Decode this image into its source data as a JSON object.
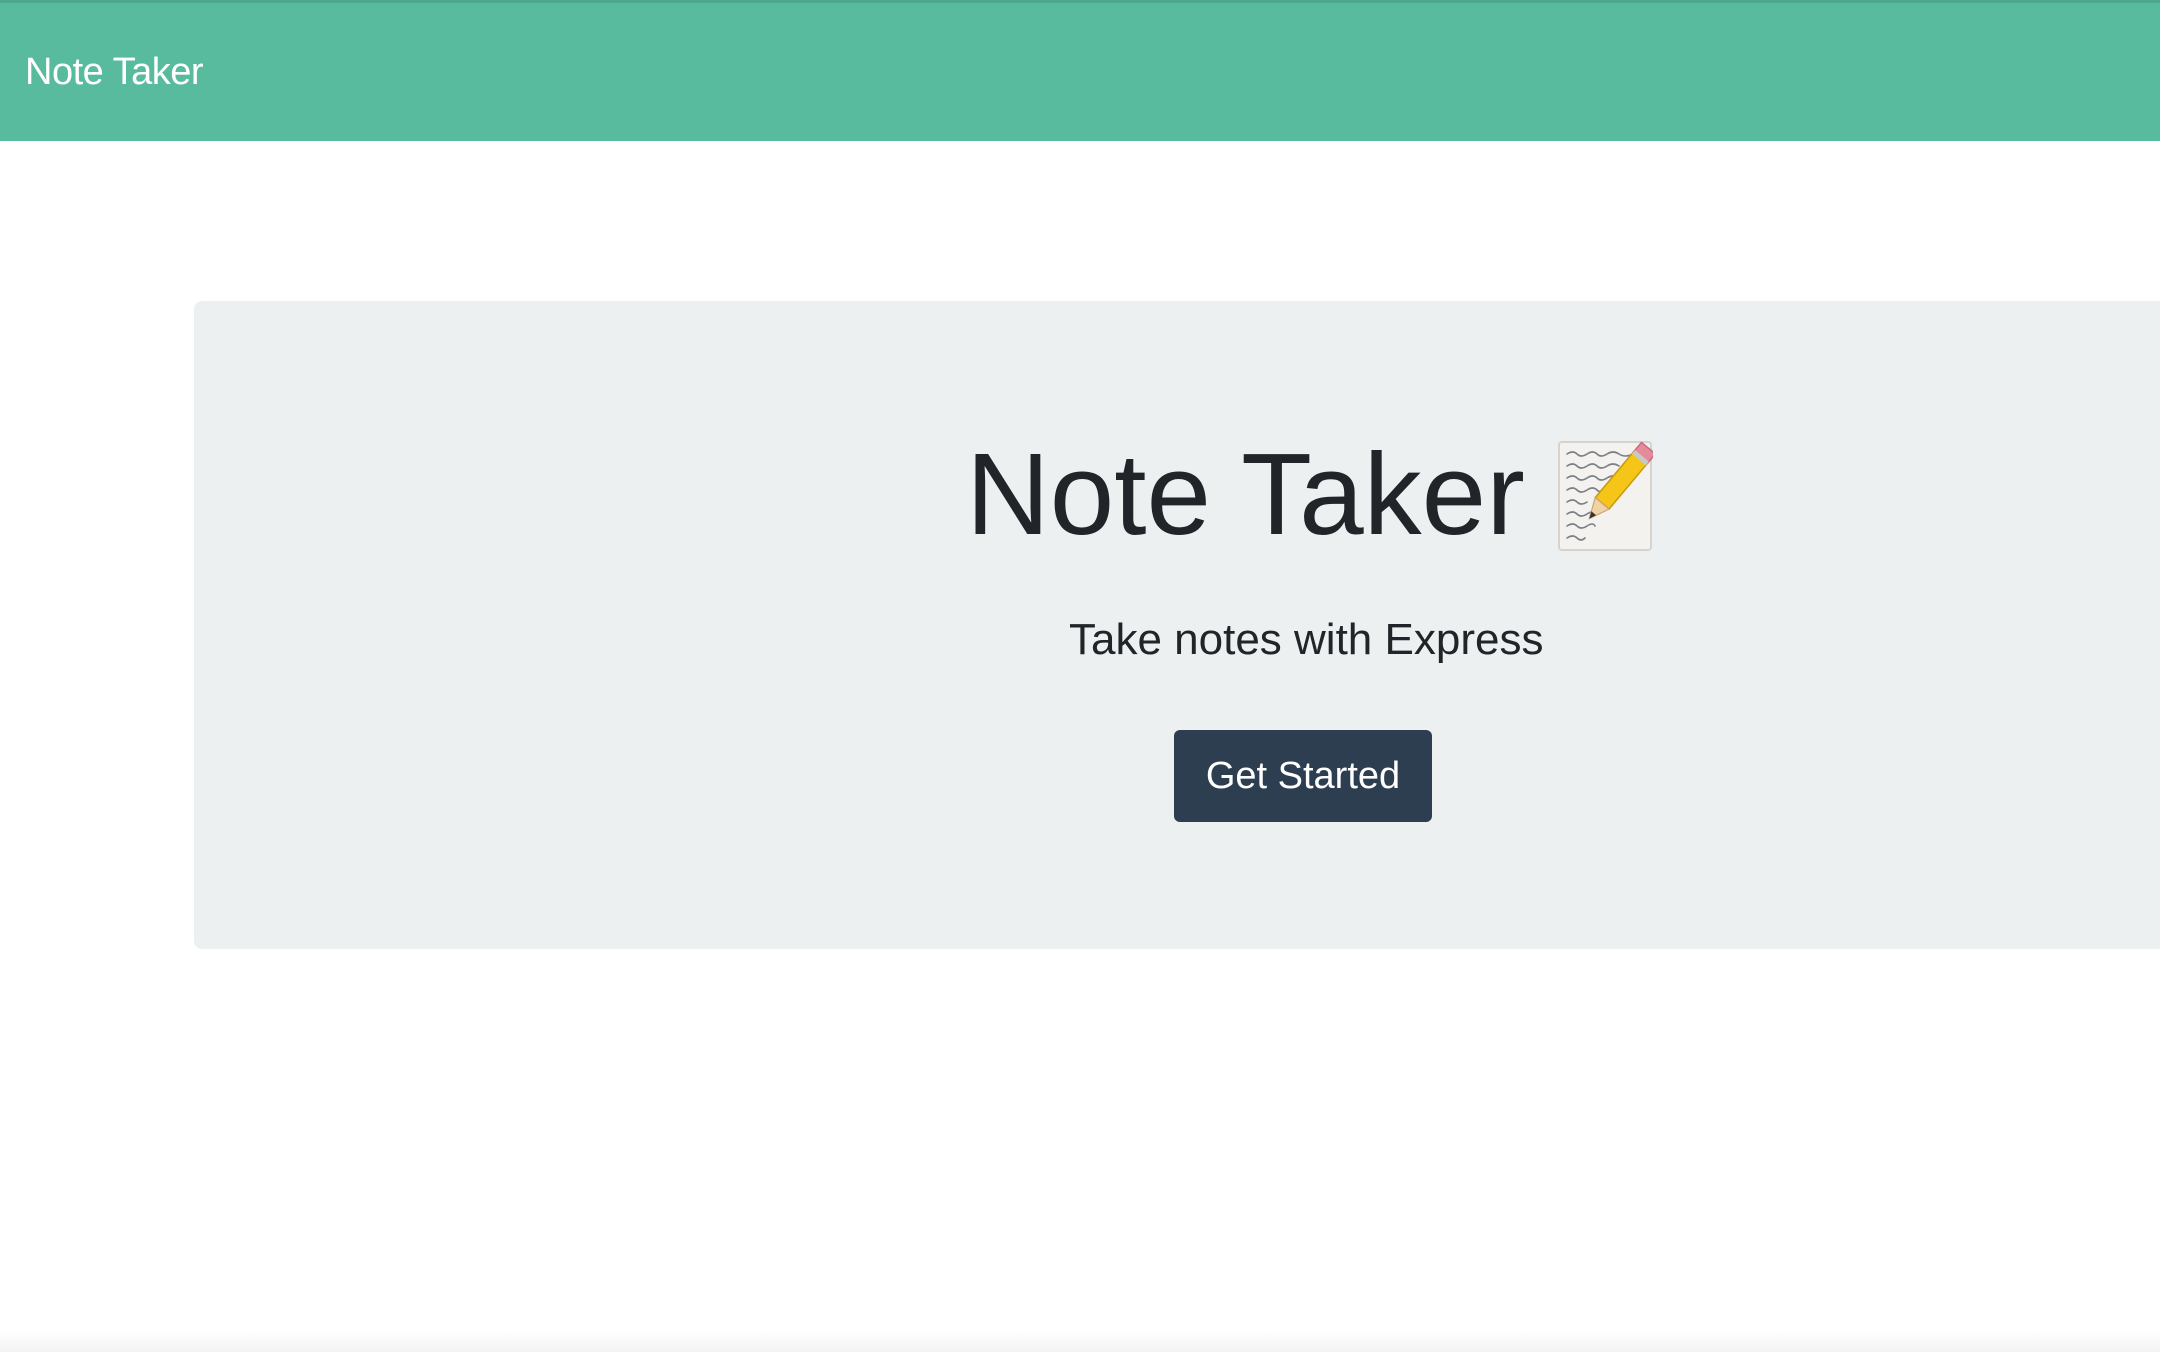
{
  "navbar": {
    "brand": "Note Taker"
  },
  "hero": {
    "title": "Note Taker",
    "title_icon": "memo-pencil-icon",
    "subtitle": "Take notes with Express",
    "cta_label": "Get Started"
  },
  "colors": {
    "navbar_bg": "#58bb9e",
    "hero_bg": "#ecf0f1",
    "button_bg": "#2d3e50",
    "text": "#212529"
  }
}
